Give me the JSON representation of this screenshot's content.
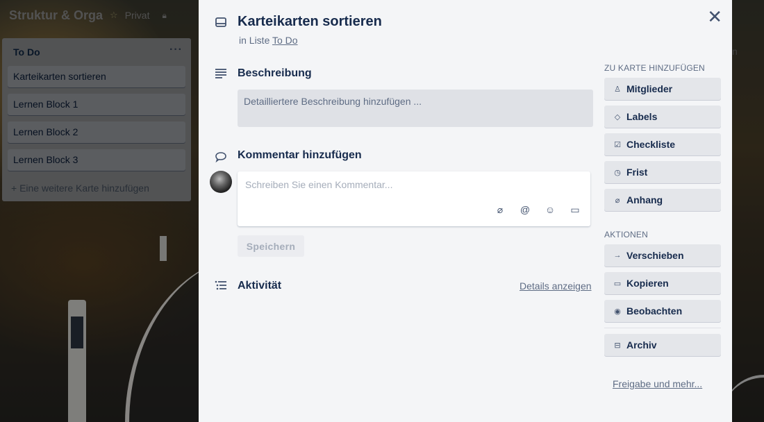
{
  "board": {
    "title": "Struktur & Orga",
    "star_icon": "star-icon",
    "privacy": "Privat",
    "lock_icon": "lock-icon"
  },
  "list": {
    "title": "To Do",
    "menu": "···",
    "cards": [
      {
        "title": "Karteikarten sortieren"
      },
      {
        "title": "Lernen Block 1"
      },
      {
        "title": "Lernen Block 2"
      },
      {
        "title": "Lernen Block 3"
      }
    ],
    "add_card": "+ Eine weitere Karte hinzufügen"
  },
  "background_peek": "n",
  "modal": {
    "close_icon": "close-icon",
    "title": "Karteikarten sortieren",
    "in_list_prefix": "in Liste",
    "in_list_name": "To Do",
    "description": {
      "title": "Beschreibung",
      "placeholder": "Detailliertere Beschreibung hinzufügen ..."
    },
    "comment": {
      "title": "Kommentar hinzufügen",
      "placeholder": "Schreiben Sie einen Kommentar...",
      "save": "Speichern",
      "tools": [
        "attachment-icon",
        "mention-icon",
        "emoji-icon",
        "card-icon"
      ]
    },
    "activity": {
      "title": "Aktivität",
      "details_link": "Details anzeigen"
    }
  },
  "sidebar": {
    "add_heading": "Zu Karte hinzufügen",
    "add_buttons": [
      {
        "label": "Mitglieder",
        "icon": "person-icon"
      },
      {
        "label": "Labels",
        "icon": "tag-icon"
      },
      {
        "label": "Checkliste",
        "icon": "checkbox-icon"
      },
      {
        "label": "Frist",
        "icon": "clock-icon"
      },
      {
        "label": "Anhang",
        "icon": "attachment-icon"
      }
    ],
    "actions_heading": "Aktionen",
    "action_buttons": [
      {
        "label": "Verschieben",
        "icon": "arrow-right-icon"
      },
      {
        "label": "Kopieren",
        "icon": "card-icon"
      },
      {
        "label": "Beobachten",
        "icon": "eye-icon"
      }
    ],
    "archive": {
      "label": "Archiv",
      "icon": "archive-icon"
    },
    "share_link": "Freigabe und mehr..."
  }
}
